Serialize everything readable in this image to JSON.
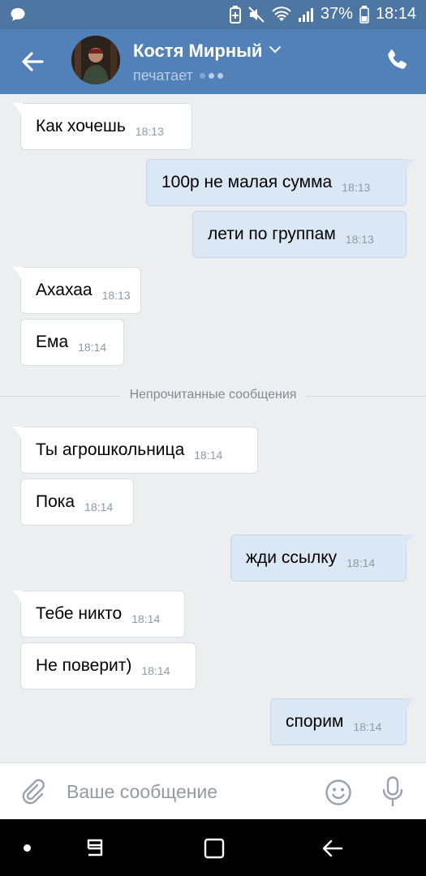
{
  "status_bar": {
    "battery_percent": "37%",
    "time": "18:14",
    "icons": [
      "chat-notification-icon",
      "battery-saver-icon",
      "mute-icon",
      "wifi-icon",
      "signal-icon",
      "battery-icon"
    ]
  },
  "header": {
    "contact_name": "Костя Мирный",
    "status": "печатает",
    "icons": [
      "back-arrow-icon",
      "chevron-down-icon",
      "phone-icon"
    ]
  },
  "messages": [
    {
      "dir": "in",
      "text": "Как хочешь",
      "time": "18:13"
    },
    {
      "dir": "out",
      "text": "100р не малая сумма",
      "time": "18:13"
    },
    {
      "dir": "out",
      "text": "лети по группам",
      "time": "18:13"
    },
    {
      "dir": "in",
      "text": "Ахахаа",
      "time": "18:13"
    },
    {
      "dir": "in",
      "text": "Ема",
      "time": "18:14"
    },
    {
      "dir": "in",
      "text": "Ты агрошкольница",
      "time": "18:14"
    },
    {
      "dir": "in",
      "text": "Пока",
      "time": "18:14"
    },
    {
      "dir": "out",
      "text": "жди ссылку",
      "time": "18:14"
    },
    {
      "dir": "in",
      "text": "Тебе никто",
      "time": "18:14"
    },
    {
      "dir": "in",
      "text": "Не поверит)",
      "time": "18:14"
    },
    {
      "dir": "out",
      "text": "спорим",
      "time": "18:14"
    }
  ],
  "unread_divider": "Непрочитанные сообщения",
  "composer": {
    "placeholder": "Ваше сообщение",
    "value": "",
    "icons": [
      "paperclip-icon",
      "emoji-icon",
      "microphone-icon"
    ]
  },
  "colors": {
    "header": "#5181b8",
    "status_bar": "#4e76a3",
    "background": "#edeef0",
    "incoming_bubble": "#ffffff",
    "outgoing_bubble": "#dce7f6"
  }
}
